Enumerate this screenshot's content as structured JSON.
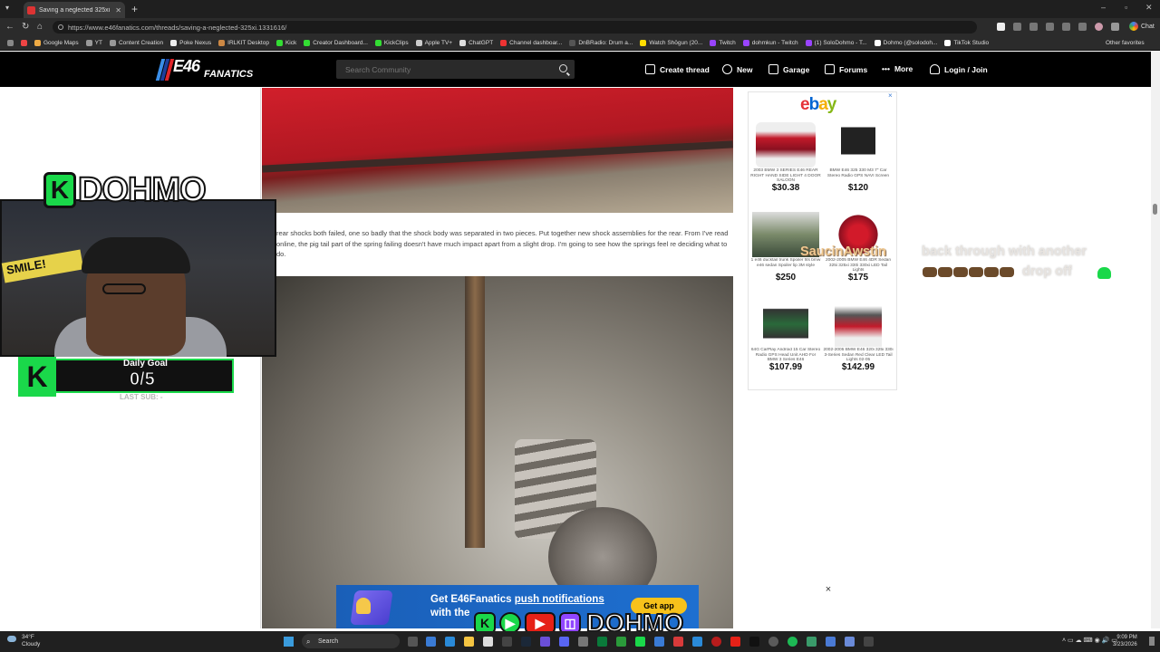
{
  "browser": {
    "tab_title": "Saving a neglected 325xi | E46 Fan...",
    "url": "https://www.e46fanatics.com/threads/saving-a-neglected-325xi.1331616/",
    "chat_label": "Chat",
    "bookmarks": [
      "Google Maps",
      "YT",
      "Content Creation",
      "Poke Nexus",
      "IRLKIT Desktop",
      "Kick",
      "Creator Dashboard...",
      "KickClips",
      "Apple TV+",
      "ChatGPT",
      "Channel dashboar...",
      "DnBRadio: Drum a...",
      "Watch Shōgun (20...",
      "Twitch",
      "dohmkun - Twitch",
      "(1) SoloDohmo - T...",
      "Dohmo (@solodoh...",
      "TikTok Studio"
    ],
    "other_favorites": "Other favorites"
  },
  "site": {
    "logo_main": "E46",
    "logo_sub": "FANATICS",
    "search_placeholder": "Search Community",
    "nav": [
      "Create thread",
      "New",
      "Garage",
      "Forums",
      "More",
      "Login / Join"
    ]
  },
  "post": {
    "text": "rear shocks both failed, one so badly that the shock body was separated in two pieces. Put together new shock assemblies for the rear. From I've read online, the pig tail part of the spring failing doesn't have much impact apart from a slight drop. I'm going to see how the springs feel re deciding what to do."
  },
  "ad": {
    "brand": "ebay",
    "close": "×",
    "items": [
      {
        "desc": "2003 BMW 3 SERIES E46 REAR RIGHT HAND SIDE LIGHT 4 DOOR SALOON",
        "price": "$30.38"
      },
      {
        "desc": "BMW E46 325 330 M3 7\" Car Stereo Radio GPS NAVI Screen",
        "price": "$120"
      },
      {
        "desc": "1 e46 ducktail trunk Spoiler fits bmw e46 sedan Spoiler lip 3M style",
        "price": "$250"
      },
      {
        "desc": "2002-2005 BMW E46 4DR Sedan 325i 325xi 330i 330xi LED Tail Lights",
        "price": "$175"
      },
      {
        "desc": "64G CarPlay Android 15 Car Stereo Radio GPS Head Unit AHD For BMW 3 Series E46",
        "price": "$107.99"
      },
      {
        "desc": "2002-2005 BMW E46 320i 325i 330i 3-Series Sedan Red Clear LED Tail Lights 02-05",
        "price": "$142.99"
      }
    ]
  },
  "push": {
    "line1_prefix": "Get E46Fanatics ",
    "line1_link": "push notifications",
    "line2": "with the ",
    "get_app": "Get app",
    "close": "×"
  },
  "stream": {
    "channel": "DOHMO",
    "k_letter": "K",
    "goal_label": "Daily Goal",
    "goal_value": "0/5",
    "last_sub": "LAST SUB: -",
    "poster": "SMILE!",
    "chat_user": "SaucinAwstin",
    "chat_msg_1": "back through with another",
    "chat_msg_2": "drop off",
    "social_name": "DOHMO"
  },
  "taskbar": {
    "temp": "34°F",
    "weather": "Cloudy",
    "search": "Search",
    "time": "9:09 PM",
    "date": "3/23/2026"
  }
}
